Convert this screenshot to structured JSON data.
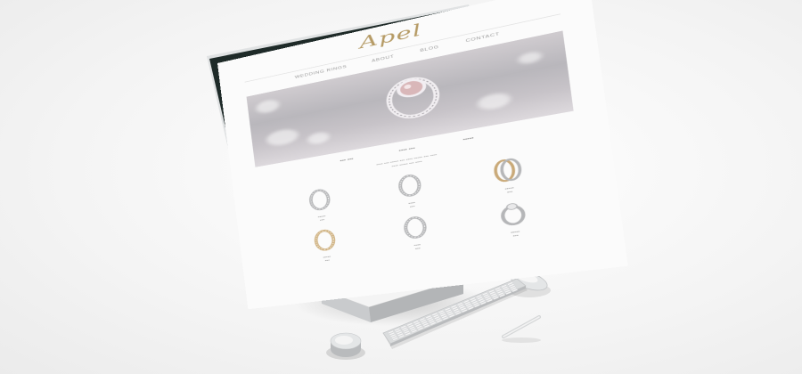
{
  "site": {
    "logo": "Apel",
    "nav": [
      "WEDDING RINGS",
      "ABOUT",
      "BLOG",
      "CONTACT"
    ]
  },
  "colors": {
    "bezel": "#1e2a28",
    "brand_gold": "#b59a64",
    "page_background": "#f3f3f3",
    "stand_silver": "#cfd1d2"
  },
  "icons": {
    "mouse": "mouse-icon",
    "keyboard": "keyboard-icon",
    "pen": "pen-icon",
    "dial": "dial-icon"
  }
}
